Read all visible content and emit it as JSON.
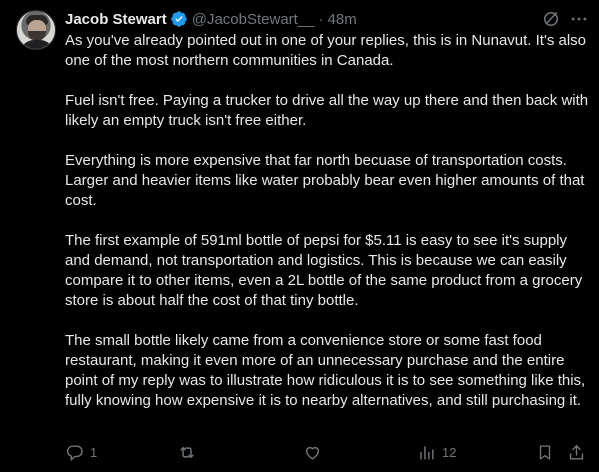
{
  "tweet": {
    "author": {
      "name": "Jacob Stewart",
      "handle": "@JacobStewart__",
      "time": "48m",
      "separator": "·"
    },
    "paragraphs": [
      "As you've already pointed out in one of your replies, this is in Nunavut. It's also one of the most northern communities in Canada.",
      "Fuel isn't free. Paying a trucker to drive all the way up there and then back with likely an empty truck isn't free either.",
      "Everything is more expensive that far north becuase of transportation costs. Larger and heavier items like water probably bear even higher amounts of that cost.",
      "The first example of 591ml bottle of pepsi for $5.11 is easy to see it's supply and demand, not transportation and logistics. This is because we can easily compare it to other items, even a 2L bottle of the same product from a grocery store is about half the cost of that tiny bottle.",
      "The small bottle likely came from a convenience store or some fast food restaurant, making it even more of an unnecessary purchase and the entire point of my reply was to illustrate how ridiculous it is to see something like this, fully knowing how expensive it is to nearby alternatives, and still purchasing it."
    ],
    "actions": {
      "reply_count": "1",
      "views_count": "12"
    }
  },
  "colors": {
    "background": "#000000",
    "text": "#e7e9ea",
    "muted": "#71767b",
    "verified": "#1d9bf0"
  },
  "icons": {
    "verified": "verified-badge-icon",
    "grok": "grok-icon",
    "more": "more-icon",
    "reply": "reply-icon",
    "repost": "repost-icon",
    "like": "heart-icon",
    "views": "views-icon",
    "bookmark": "bookmark-icon",
    "share": "share-icon"
  }
}
